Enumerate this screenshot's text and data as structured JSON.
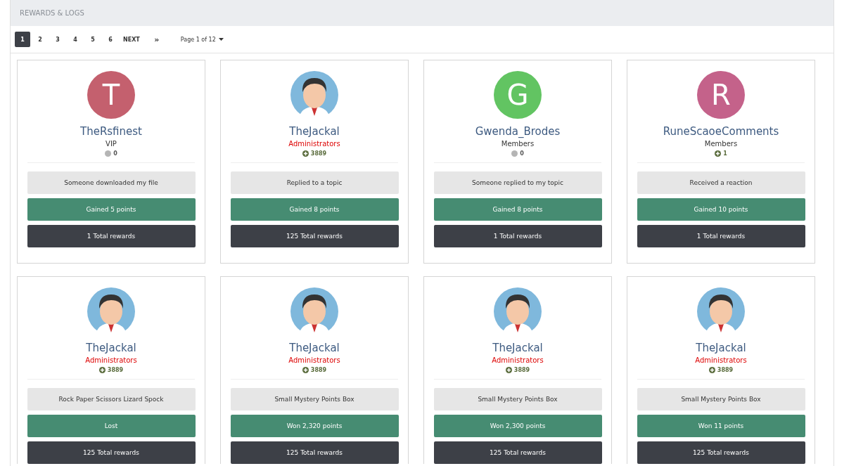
{
  "panel": {
    "title": "REWARDS & LOGS"
  },
  "pagination": {
    "pages": [
      {
        "label": "1",
        "selected": true
      },
      {
        "label": "2",
        "selected": false
      },
      {
        "label": "3",
        "selected": false
      },
      {
        "label": "4",
        "selected": false
      },
      {
        "label": "5",
        "selected": false
      },
      {
        "label": "6",
        "selected": false
      }
    ],
    "next": "NEXT",
    "last": "»",
    "page_info": "Page 1 of 12"
  },
  "cards": [
    {
      "avatar": {
        "kind": "letter",
        "letter": "T",
        "color": "#c4606e"
      },
      "name": "TheRsfinest",
      "group": {
        "label": "VIP",
        "color": "#333333"
      },
      "reputation": {
        "kind": "neutral",
        "value": "0"
      },
      "action": "Someone downloaded my file",
      "result": "Gained 5 points",
      "total": "1 Total rewards"
    },
    {
      "avatar": {
        "kind": "picture"
      },
      "name": "TheJackal",
      "group": {
        "label": "Administrators",
        "color": "#dd0000"
      },
      "reputation": {
        "kind": "positive",
        "value": "3889"
      },
      "action": "Replied to a topic",
      "result": "Gained 8 points",
      "total": "125 Total rewards"
    },
    {
      "avatar": {
        "kind": "letter",
        "letter": "G",
        "color": "#62c462"
      },
      "name": "Gwenda_Brodes",
      "group": {
        "label": "Members",
        "color": "#333333"
      },
      "reputation": {
        "kind": "neutral",
        "value": "0"
      },
      "action": "Someone replied to my topic",
      "result": "Gained 8 points",
      "total": "1 Total rewards"
    },
    {
      "avatar": {
        "kind": "letter",
        "letter": "R",
        "color": "#c4628a"
      },
      "name": "RuneScaoeComments",
      "group": {
        "label": "Members",
        "color": "#333333"
      },
      "reputation": {
        "kind": "positive",
        "value": "1"
      },
      "action": "Received a reaction",
      "result": "Gained 10 points",
      "total": "1 Total rewards"
    },
    {
      "avatar": {
        "kind": "picture"
      },
      "name": "TheJackal",
      "group": {
        "label": "Administrators",
        "color": "#dd0000"
      },
      "reputation": {
        "kind": "positive",
        "value": "3889"
      },
      "action": "Rock Paper Scissors Lizard Spock",
      "result": "Lost",
      "total": "125 Total rewards"
    },
    {
      "avatar": {
        "kind": "picture"
      },
      "name": "TheJackal",
      "group": {
        "label": "Administrators",
        "color": "#dd0000"
      },
      "reputation": {
        "kind": "positive",
        "value": "3889"
      },
      "action": "Small Mystery Points Box",
      "result": "Won 2,320 points",
      "total": "125 Total rewards"
    },
    {
      "avatar": {
        "kind": "picture"
      },
      "name": "TheJackal",
      "group": {
        "label": "Administrators",
        "color": "#dd0000"
      },
      "reputation": {
        "kind": "positive",
        "value": "3889"
      },
      "action": "Small Mystery Points Box",
      "result": "Won 2,300 points",
      "total": "125 Total rewards"
    },
    {
      "avatar": {
        "kind": "picture"
      },
      "name": "TheJackal",
      "group": {
        "label": "Administrators",
        "color": "#dd0000"
      },
      "reputation": {
        "kind": "positive",
        "value": "3889"
      },
      "action": "Small Mystery Points Box",
      "result": "Won 11 points",
      "total": "125 Total rewards"
    }
  ]
}
